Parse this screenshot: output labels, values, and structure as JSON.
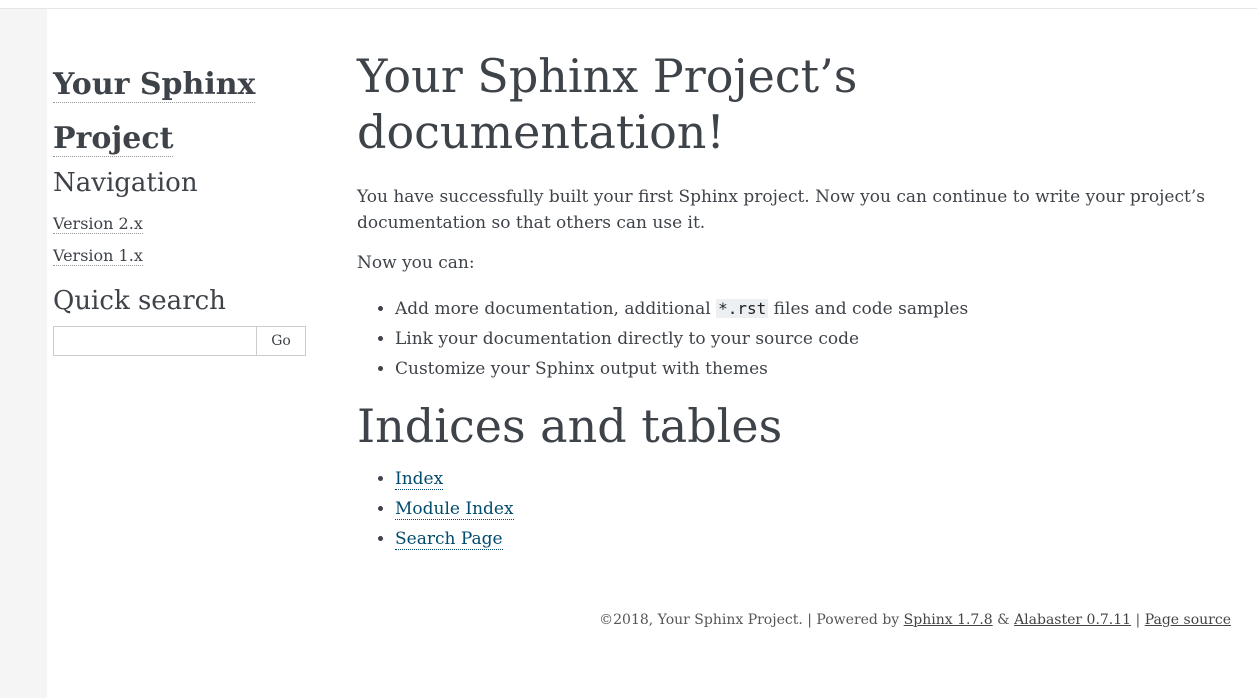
{
  "sidebar": {
    "logo_line1": "Your Sphinx",
    "logo_line2": "Project",
    "navigation_heading": "Navigation",
    "nav_items": [
      "Version 2.x",
      "Version 1.x"
    ],
    "quick_search_heading": "Quick search",
    "search_value": "",
    "go_label": "Go"
  },
  "main": {
    "title_line1": "Your Sphinx Project’s",
    "title_line2": "documentation!",
    "intro": "You have successfully built your first Sphinx project. Now you can continue to write your project’s documentation so that others can use it.",
    "now_you_can": "Now you can:",
    "bullets": {
      "b1_pre": "Add more documentation, additional ",
      "b1_code": "*.rst",
      "b1_post": " files and code samples",
      "b2": "Link your documentation directly to your source code",
      "b3": "Customize your Sphinx output with themes"
    },
    "indices_heading": "Indices and tables",
    "indices": [
      "Index",
      "Module Index",
      "Search Page"
    ]
  },
  "footer": {
    "copyright": "©2018, Your Sphinx Project. | Powered by ",
    "sphinx_link": "Sphinx 1.7.8",
    "amp": " & ",
    "alabaster_link": "Alabaster 0.7.11",
    "sep": " | ",
    "page_source_link": "Page source"
  }
}
